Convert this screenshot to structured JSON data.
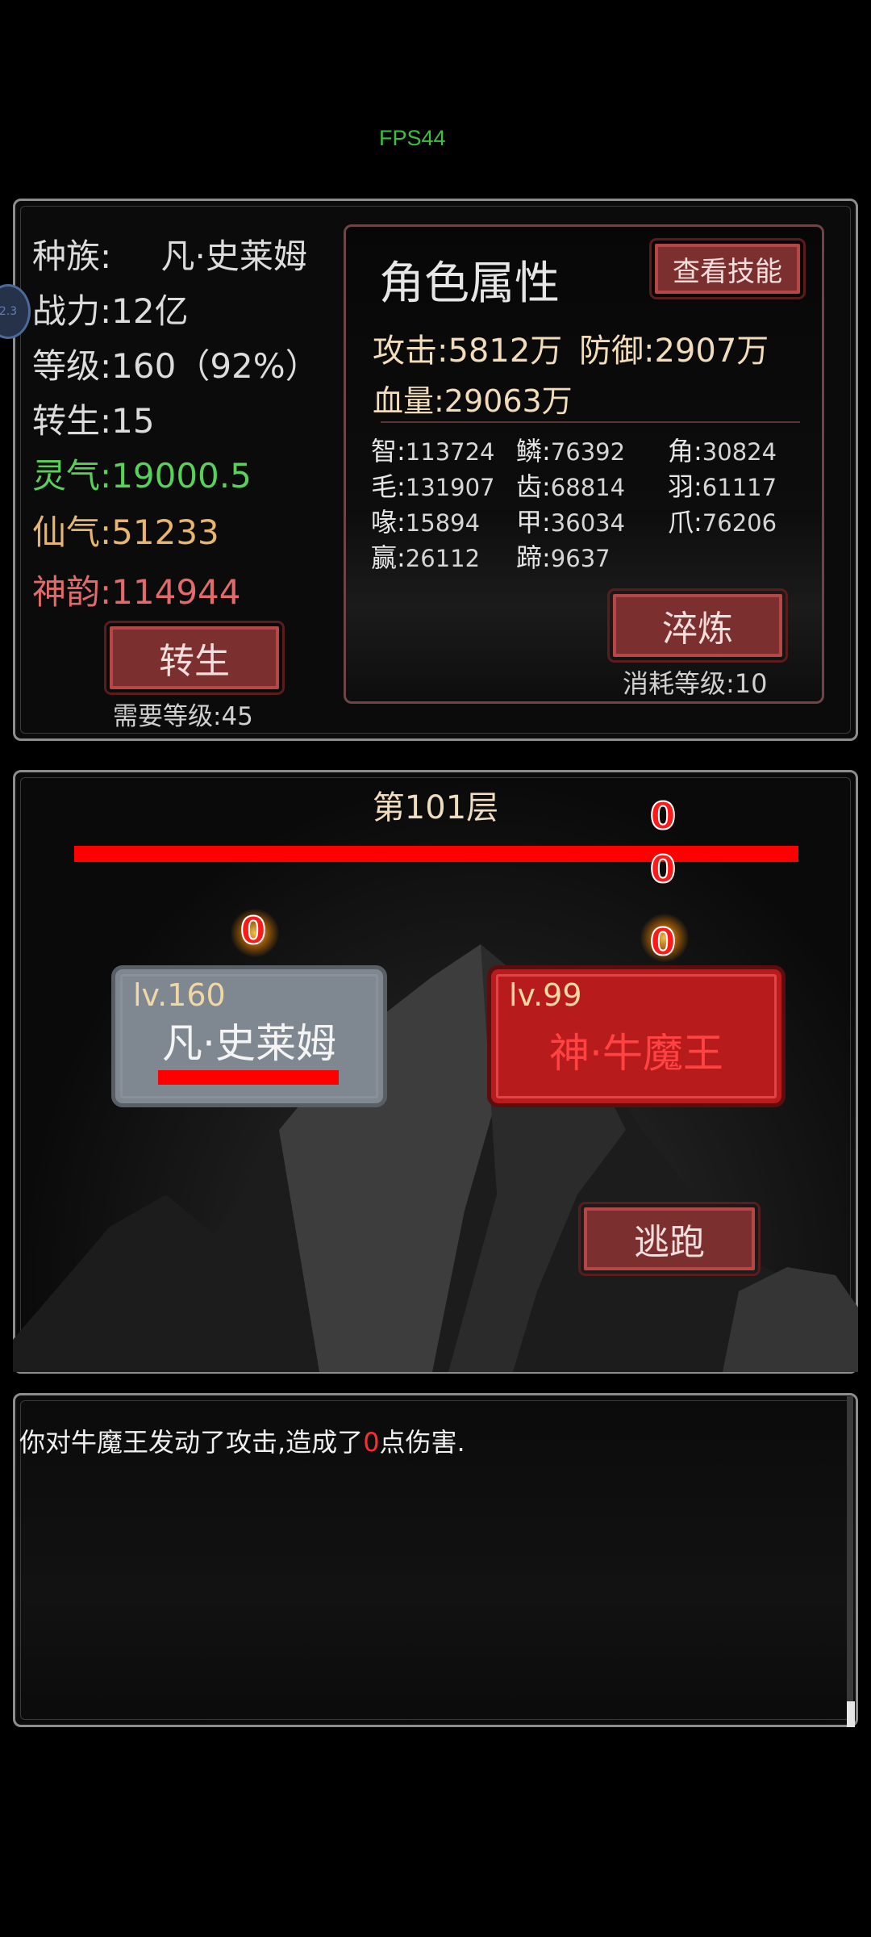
{
  "fps": "FPS44",
  "overlay": {
    "bubble": "2.3"
  },
  "stats": {
    "race_label": "种族:",
    "race_value": "凡·史莱姆",
    "power": "战力:12亿",
    "level": "等级:160（92%）",
    "rebirth": "转生:15",
    "lingqi": "灵气:19000.5",
    "xianqi": "仙气:51233",
    "shenyun": "神韵:114944",
    "rebirth_button": "转生",
    "rebirth_requirement": "需要等级:45"
  },
  "attributes": {
    "title": "角色属性",
    "view_skills_button": "查看技能",
    "attack": "攻击:5812万",
    "defense": "防御:2907万",
    "hp": "血量:29063万",
    "grid": [
      {
        "label": "智:",
        "value": "113724"
      },
      {
        "label": "鳞:",
        "value": "76392"
      },
      {
        "label": "角:",
        "value": "30824"
      },
      {
        "label": "毛:",
        "value": "131907"
      },
      {
        "label": "齿:",
        "value": "68814"
      },
      {
        "label": "羽:",
        "value": "61117"
      },
      {
        "label": "喙:",
        "value": "15894"
      },
      {
        "label": "甲:",
        "value": "36034"
      },
      {
        "label": "爪:",
        "value": "76206"
      },
      {
        "label": "赢:",
        "value": "26112"
      },
      {
        "label": "蹄:",
        "value": "9637"
      }
    ],
    "refine_button": "淬炼",
    "refine_cost": "消耗等级:10"
  },
  "battle": {
    "floor": "第101层",
    "enemy_hp_fraction": 1.0,
    "player_hp_fraction": 1.0,
    "damage_numbers": [
      "0",
      "0",
      "0",
      "0"
    ],
    "player": {
      "level": "lv.160",
      "name": "凡·史莱姆"
    },
    "enemy": {
      "level": "lv.99",
      "name": "神·牛魔王"
    },
    "flee_button": "逃跑"
  },
  "log": {
    "prefix": "你对牛魔王发动了攻击,造成了",
    "damage": "0",
    "suffix": "点伤害."
  },
  "colors": {
    "accent_red": "#ff0000",
    "button_red": "#7c2f2f",
    "green": "#58d05a",
    "gold": "#e7b56e"
  }
}
